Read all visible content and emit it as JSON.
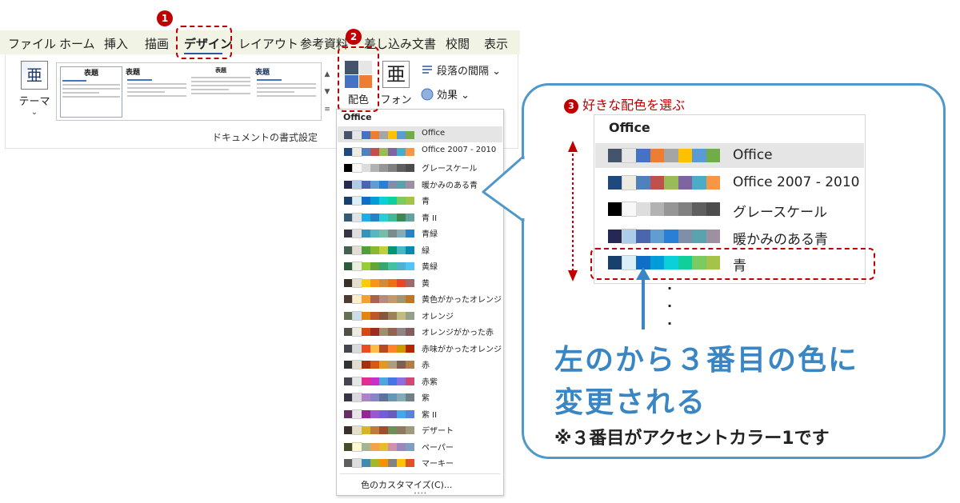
{
  "ribbon": {
    "tabs": [
      "ファイル",
      "ホーム",
      "挿入",
      "描画",
      "デザイン",
      "レイアウト",
      "参考資料",
      "差し込み文書",
      "校閲",
      "表示"
    ],
    "active_tab": "デザイン",
    "theme_label": "テーマ",
    "theme_glyph": "亜",
    "gallery_title": "表題",
    "group_label": "ドキュメントの書式設定",
    "colors_label": "配色",
    "font_label": "フォント",
    "font_glyph": "亜",
    "spacing_label": "段落の間隔",
    "effects_label": "効果"
  },
  "steps": {
    "step1": "1",
    "step2": "2",
    "step3": "3",
    "step3_text": "好きな配色を選ぶ"
  },
  "dropdown": {
    "header": "Office",
    "customize": "色のカスタマイズ(C)...",
    "items": [
      {
        "name": "Office",
        "colors": [
          "#44546a",
          "#e7e6e6",
          "#4472c4",
          "#ed7d31",
          "#a5a5a5",
          "#ffc000",
          "#5b9bd5",
          "#70ad47"
        ]
      },
      {
        "name": "Office 2007 - 2010",
        "colors": [
          "#1f497d",
          "#eeece1",
          "#4f81bd",
          "#c0504d",
          "#9bbb59",
          "#8064a2",
          "#4bacc6",
          "#f79646"
        ]
      },
      {
        "name": "グレースケール",
        "colors": [
          "#000000",
          "#f8f8f8",
          "#dddddd",
          "#b2b2b2",
          "#969696",
          "#808080",
          "#5f5f5f",
          "#4d4d4d"
        ]
      },
      {
        "name": "暖かみのある青",
        "colors": [
          "#242852",
          "#acccea",
          "#4a66ac",
          "#629dd1",
          "#297fd5",
          "#7f8fa9",
          "#5aa2ae",
          "#9d90a0"
        ]
      },
      {
        "name": "青",
        "colors": [
          "#17406d",
          "#dbeff9",
          "#0f6fc6",
          "#009dd9",
          "#0bd0d9",
          "#10cf9b",
          "#7cca62",
          "#a5c249"
        ]
      },
      {
        "name": "青 II",
        "colors": [
          "#335b74",
          "#dfe3e5",
          "#1cade4",
          "#2683c6",
          "#27ced7",
          "#42ba97",
          "#3e8853",
          "#62a39f"
        ]
      },
      {
        "name": "青緑",
        "colors": [
          "#373545",
          "#dedede",
          "#3494ba",
          "#58b6c0",
          "#75bda7",
          "#7a8c8e",
          "#84acb6",
          "#2683c6"
        ]
      },
      {
        "name": "緑",
        "colors": [
          "#455f51",
          "#e3ded1",
          "#549e39",
          "#8ab833",
          "#c0cf3a",
          "#029676",
          "#4ab5c4",
          "#0989b1"
        ]
      },
      {
        "name": "黄緑",
        "colors": [
          "#2c5c3a",
          "#eaf0dc",
          "#99cb38",
          "#63a537",
          "#37a76f",
          "#44c1a3",
          "#4eb3cf",
          "#51c3f9"
        ]
      },
      {
        "name": "黄",
        "colors": [
          "#39302a",
          "#e5dec8",
          "#ffca08",
          "#f8931d",
          "#ce8d3e",
          "#ec7016",
          "#e64823",
          "#9c6a6a"
        ]
      },
      {
        "name": "黄色がかったオレンジ",
        "colors": [
          "#4e3b30",
          "#fbeec9",
          "#f0a22e",
          "#a5644e",
          "#b58b80",
          "#c3986d",
          "#a19574",
          "#c17529"
        ]
      },
      {
        "name": "オレンジ",
        "colors": [
          "#637052",
          "#ccddea",
          "#e48312",
          "#bd582c",
          "#865640",
          "#9b8357",
          "#c2bc80",
          "#94a088"
        ]
      },
      {
        "name": "オレンジがかった赤",
        "colors": [
          "#505046",
          "#eeece1",
          "#d34817",
          "#9b2d1f",
          "#a28e6a",
          "#956251",
          "#918485",
          "#855d5d"
        ]
      },
      {
        "name": "赤味がかったオレンジ",
        "colors": [
          "#454551",
          "#d8d9dc",
          "#e84c22",
          "#ffbd47",
          "#b64926",
          "#ff8427",
          "#cc9900",
          "#b22600"
        ]
      },
      {
        "name": "赤",
        "colors": [
          "#323232",
          "#e3ded1",
          "#a5300f",
          "#d55816",
          "#e19825",
          "#b19c7d",
          "#7f5f52",
          "#b27d49"
        ]
      },
      {
        "name": "赤紫",
        "colors": [
          "#454551",
          "#e7e6e6",
          "#e32d91",
          "#c830cc",
          "#4ea6dc",
          "#4775e7",
          "#8971e1",
          "#d54773"
        ]
      },
      {
        "name": "紫",
        "colors": [
          "#373545",
          "#dcd8dc",
          "#ad84c6",
          "#8784c7",
          "#5d739a",
          "#6997af",
          "#84acb6",
          "#6f8183"
        ]
      },
      {
        "name": "紫 II",
        "colors": [
          "#632e62",
          "#eae5eb",
          "#92278f",
          "#9b57d3",
          "#755dd9",
          "#665eb8",
          "#45a5ed",
          "#5982db"
        ]
      },
      {
        "name": "デザート",
        "colors": [
          "#39302a",
          "#e5dec8",
          "#d5b52b",
          "#c07b3a",
          "#a34e2a",
          "#6e8f5a",
          "#8e7b5f",
          "#9f9a7c"
        ]
      },
      {
        "name": "ペーパー",
        "colors": [
          "#444d26",
          "#fefac9",
          "#a5b592",
          "#f3a447",
          "#e7bc29",
          "#d092a7",
          "#9c85c0",
          "#809ec2"
        ]
      },
      {
        "name": "マーキー",
        "colors": [
          "#5e5e5e",
          "#dddddd",
          "#418ab3",
          "#a6b727",
          "#f69200",
          "#838383",
          "#fec306",
          "#df5327"
        ]
      }
    ]
  },
  "zoom": {
    "header": "Office",
    "items": [
      {
        "name": "Office",
        "colors": [
          "#44546a",
          "#e7e6e6",
          "#4472c4",
          "#ed7d31",
          "#a5a5a5",
          "#ffc000",
          "#5b9bd5",
          "#70ad47"
        ]
      },
      {
        "name": "Office 2007 - 2010",
        "colors": [
          "#1f497d",
          "#eeece1",
          "#4f81bd",
          "#c0504d",
          "#9bbb59",
          "#8064a2",
          "#4bacc6",
          "#f79646"
        ]
      },
      {
        "name": "グレースケール",
        "colors": [
          "#000000",
          "#f8f8f8",
          "#dddddd",
          "#b2b2b2",
          "#969696",
          "#808080",
          "#5f5f5f",
          "#4d4d4d"
        ]
      },
      {
        "name": "暖かみのある青",
        "colors": [
          "#242852",
          "#acccea",
          "#4a66ac",
          "#629dd1",
          "#297fd5",
          "#7f8fa9",
          "#5aa2ae",
          "#9d90a0"
        ]
      },
      {
        "name": "青",
        "colors": [
          "#17406d",
          "#dbeff9",
          "#0f6fc6",
          "#009dd9",
          "#0bd0d9",
          "#10cf9b",
          "#7cca62",
          "#a5c249"
        ]
      }
    ]
  },
  "message": {
    "line1": "左のから３番目の色に",
    "line2": "変更される",
    "note": "※３番目がアクセントカラー1です"
  },
  "colors": {
    "accent_red": "#c00000",
    "callout_blue": "#4f98c8",
    "message_blue": "#3a86c4"
  }
}
